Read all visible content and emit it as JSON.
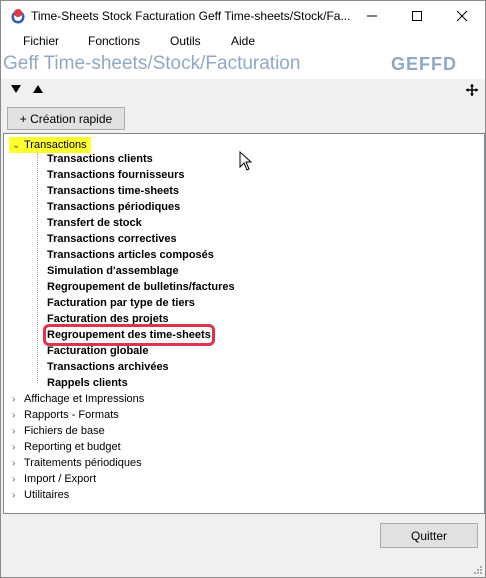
{
  "window": {
    "title": "Time-Sheets Stock Facturation  Geff Time-sheets/Stock/Fa...",
    "controls": {
      "minimize": "—",
      "maximize": "☐",
      "close": "✕"
    }
  },
  "menu": {
    "items": [
      {
        "label": "Fichier"
      },
      {
        "label": "Fonctions"
      },
      {
        "label": "Outils"
      },
      {
        "label": "Aide"
      }
    ]
  },
  "banner": {
    "title": "Geff Time-sheets/Stock/Facturation",
    "logo": "GEFFD"
  },
  "toolbar": {
    "collapse_glyph": "▼",
    "expand_glyph": "▲",
    "quick_create_label": "+ Création rapide"
  },
  "tree": {
    "root": {
      "label": "Transactions",
      "expanded": true,
      "children": [
        "Transactions clients",
        "Transactions fournisseurs",
        "Transactions time-sheets",
        "Transactions périodiques",
        "Transfert de stock",
        "Transactions correctives",
        "Transactions articles composés",
        "Simulation d'assemblage",
        "Regroupement de bulletins/factures",
        "Facturation par type de tiers",
        "Facturation des projets",
        "Regroupement des time-sheets",
        "Facturation globale",
        "Transactions archivées",
        "Rappels clients"
      ],
      "selected_child": "Regroupement des time-sheets"
    },
    "collapsed": [
      "Affichage et Impressions",
      "Rapports - Formats",
      "Fichiers de base",
      "Reporting et budget",
      "Traitements périodiques",
      "Import / Export",
      "Utilitaires"
    ]
  },
  "footer": {
    "quit_label": "Quitter"
  },
  "colors": {
    "highlight": "#ffff2e",
    "selection_outline": "#e0324b",
    "banner_text": "#8fa8c7"
  }
}
